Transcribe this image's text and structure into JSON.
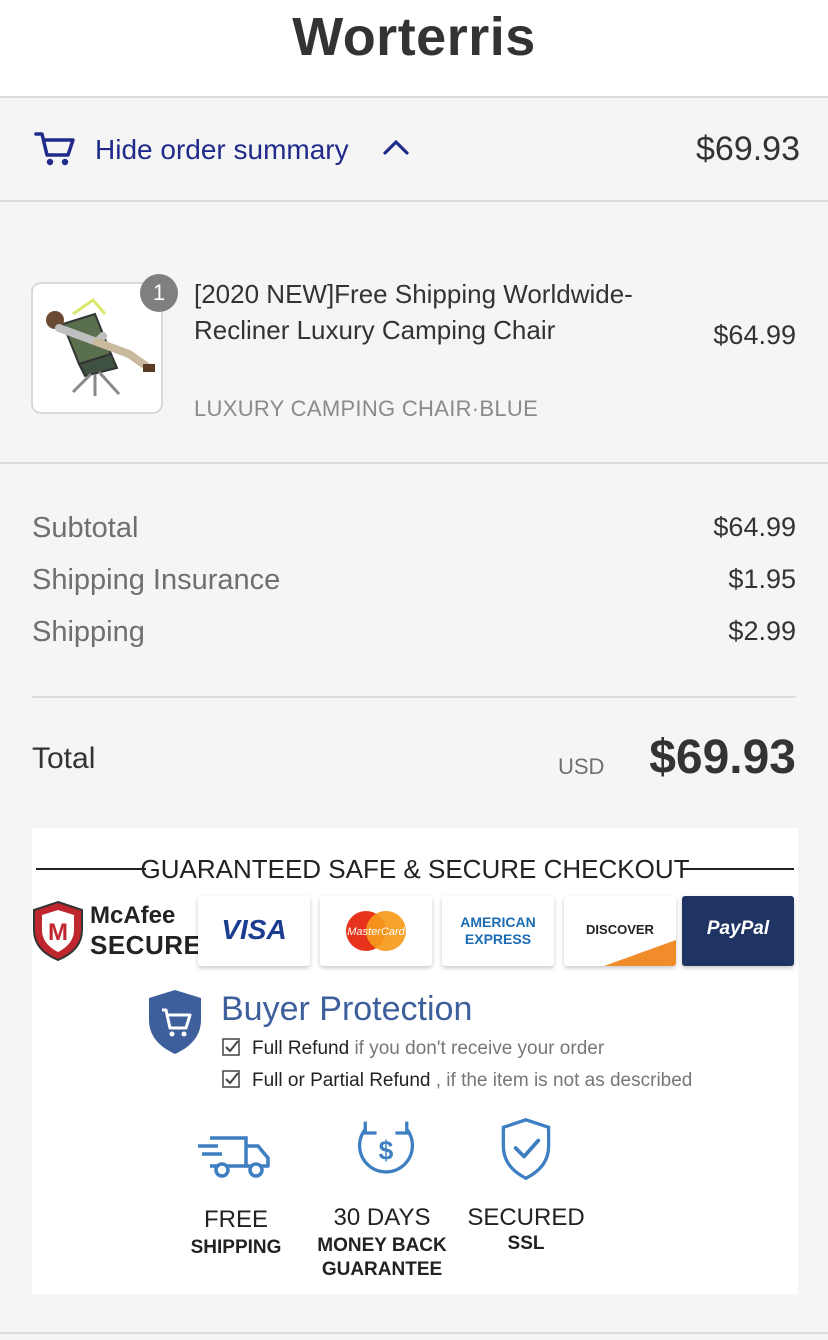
{
  "header": {
    "store_name": "Worterris"
  },
  "order_summary_toggle": {
    "icon": "cart-icon",
    "label": "Hide order summary",
    "chevron": "chevron-up-icon",
    "total": "$69.93"
  },
  "product": {
    "quantity": "1",
    "title": "[2020 NEW]Free Shipping Worldwide-Recliner Luxury Camping Chair",
    "variant": "LUXURY CAMPING CHAIR·BLUE",
    "price": "$64.99"
  },
  "costs": {
    "lines": [
      {
        "label": "Subtotal",
        "value": "$64.99"
      },
      {
        "label": "Shipping Insurance",
        "value": "$1.95"
      },
      {
        "label": "Shipping",
        "value": "$2.99"
      }
    ],
    "total_label": "Total",
    "currency": "USD",
    "total_value": "$69.93"
  },
  "trust_banner": {
    "title": "GUARANTEED SAFE & SECURE CHECKOUT",
    "mcafee": {
      "name": "McAfee",
      "secure": "SECURE",
      "badge_letter": "M"
    },
    "payment_logos": [
      "VISA",
      "MasterCard",
      "AMERICAN EXPRESS",
      "DISCOVER",
      "PayPal"
    ],
    "buyer_protection": {
      "title": "Buyer Protection",
      "items": [
        {
          "bold": "Full Refund",
          "rest": " if you don't receive your order"
        },
        {
          "bold": "Full or Partial Refund",
          "rest": " , if the item is not as described"
        }
      ]
    },
    "features": [
      {
        "icon": "truck-icon",
        "line1": "FREE",
        "line2": "SHIPPING"
      },
      {
        "icon": "money-back-icon",
        "line1": "30 DAYS",
        "line2": "MONEY BACK GUARANTEE"
      },
      {
        "icon": "shield-check-icon",
        "line1": "SECURED",
        "line2": "SSL"
      }
    ]
  },
  "colors": {
    "link_blue": "#1f2a8a",
    "protection_blue": "#3d5f9c",
    "paypal_navy": "#1f3462",
    "mcafee_red": "#c0262d"
  }
}
